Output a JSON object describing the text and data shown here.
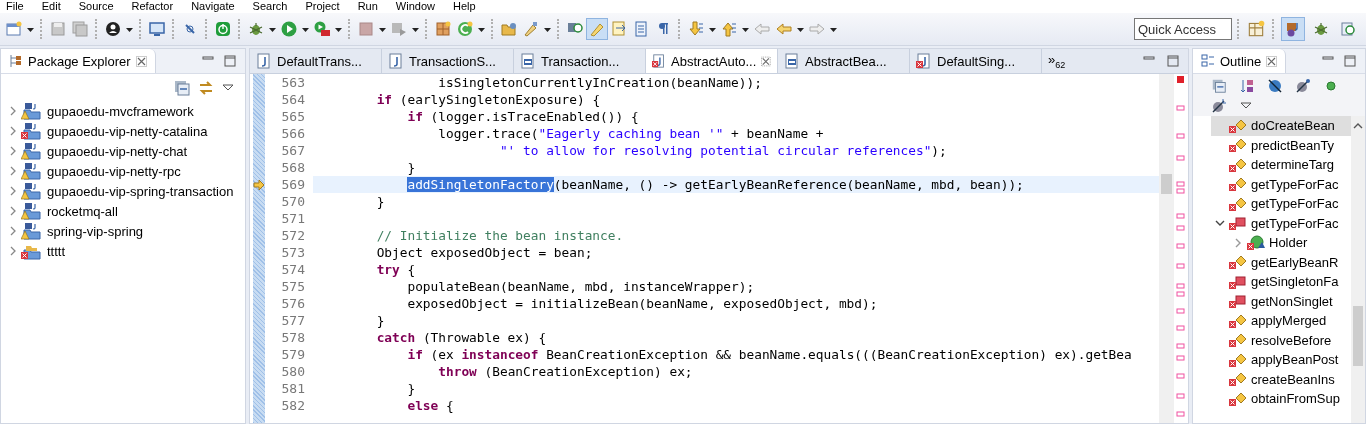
{
  "menu_bar": [
    "File",
    "Edit",
    "Source",
    "Refactor",
    "Navigate",
    "Search",
    "Project",
    "Run",
    "Window",
    "Help"
  ],
  "toolbar": {
    "highlight_toggle": {
      "selected": true
    },
    "quick_access": {
      "placeholder": "Quick Access"
    },
    "perspectives": [
      {
        "kind": "javaee",
        "selected": true
      },
      {
        "kind": "debug",
        "selected": false
      },
      {
        "kind": "search",
        "selected": false
      }
    ]
  },
  "package_explorer": {
    "title": "Package Explorer",
    "projects": [
      {
        "name": "gupaoedu-mvcframework",
        "kind": "maven",
        "has_error": false,
        "expanded": false
      },
      {
        "name": "gupaoedu-vip-netty-catalina",
        "kind": "maven",
        "has_error": true,
        "expanded": false
      },
      {
        "name": "gupaoedu-vip-netty-chat",
        "kind": "maven",
        "has_error": false,
        "expanded": false
      },
      {
        "name": "gupaoedu-vip-netty-rpc",
        "kind": "maven",
        "has_error": false,
        "expanded": false
      },
      {
        "name": "gupaoedu-vip-spring-transaction",
        "kind": "maven",
        "has_error": false,
        "expanded": false
      },
      {
        "name": "rocketmq-all",
        "kind": "maven",
        "has_error": false,
        "expanded": false
      },
      {
        "name": "spring-vip-spring",
        "kind": "maven",
        "has_error": false,
        "expanded": false
      },
      {
        "name": "ttttt",
        "kind": "plain",
        "has_error": true,
        "expanded": false
      }
    ]
  },
  "editor": {
    "tabs": [
      {
        "label": "DefaultTrans...",
        "kind": "source",
        "error": false,
        "selected": false
      },
      {
        "label": "TransactionS...",
        "kind": "source",
        "error": false,
        "selected": false
      },
      {
        "label": "Transaction...",
        "kind": "class",
        "error": false,
        "selected": false
      },
      {
        "label": "AbstractAuto...",
        "kind": "source",
        "error": true,
        "selected": true
      },
      {
        "label": "AbstractBea...",
        "kind": "class",
        "error": false,
        "selected": false
      },
      {
        "label": "DefaultSing...",
        "kind": "source",
        "error": true,
        "selected": false
      }
    ],
    "overflow": {
      "chevron": "»",
      "count": "62"
    },
    "lines": [
      {
        "number": "563",
        "current": false,
        "segments": [
          {
            "kind": "plain",
            "text": "                isSingletonCurrentlyInCreation(beanName));"
          }
        ]
      },
      {
        "number": "564",
        "current": false,
        "segments": [
          {
            "kind": "keyword",
            "text": "        if"
          },
          {
            "kind": "plain",
            "text": " (earlySingletonExposure) {"
          }
        ]
      },
      {
        "number": "565",
        "current": false,
        "segments": [
          {
            "kind": "keyword",
            "text": "            if"
          },
          {
            "kind": "plain",
            "text": " (logger.isTraceEnabled()) {"
          }
        ]
      },
      {
        "number": "566",
        "current": false,
        "segments": [
          {
            "kind": "plain",
            "text": "                logger.trace("
          },
          {
            "kind": "string",
            "text": "\"Eagerly caching bean '\""
          },
          {
            "kind": "plain",
            "text": " + beanName +"
          }
        ]
      },
      {
        "number": "567",
        "current": false,
        "segments": [
          {
            "kind": "string",
            "text": "                        \"' to allow for resolving potential circular references\""
          },
          {
            "kind": "plain",
            "text": ");"
          }
        ]
      },
      {
        "number": "568",
        "current": false,
        "segments": [
          {
            "kind": "plain",
            "text": "            }"
          }
        ]
      },
      {
        "number": "569",
        "current": true,
        "segments": [
          {
            "kind": "selection",
            "text": "            addSingletonFactory"
          },
          {
            "kind": "plain",
            "text": "(beanName, () -> getEarlyBeanReference(beanName, mbd, bean));"
          }
        ]
      },
      {
        "number": "570",
        "current": false,
        "segments": [
          {
            "kind": "plain",
            "text": "        }"
          }
        ]
      },
      {
        "number": "571",
        "current": false
      },
      {
        "number": "572",
        "current": false,
        "segments": [
          {
            "kind": "comment",
            "text": "        // Initialize the bean instance."
          }
        ]
      },
      {
        "number": "573",
        "current": false,
        "segments": [
          {
            "kind": "plain",
            "text": "        Object exposedObject = bean;"
          }
        ]
      },
      {
        "number": "574",
        "current": false,
        "segments": [
          {
            "kind": "keyword",
            "text": "        try"
          },
          {
            "kind": "plain",
            "text": " {"
          }
        ]
      },
      {
        "number": "575",
        "current": false,
        "segments": [
          {
            "kind": "plain",
            "text": "            populateBean(beanName, mbd, instanceWrapper);"
          }
        ]
      },
      {
        "number": "576",
        "current": false,
        "segments": [
          {
            "kind": "plain",
            "text": "            exposedObject = initializeBean(beanName, exposedObject, mbd);"
          }
        ]
      },
      {
        "number": "577",
        "current": false,
        "segments": [
          {
            "kind": "plain",
            "text": "        }"
          }
        ]
      },
      {
        "number": "578",
        "current": false,
        "segments": [
          {
            "kind": "keyword",
            "text": "        catch"
          },
          {
            "kind": "plain",
            "text": " (Throwable ex) {"
          }
        ]
      },
      {
        "number": "579",
        "current": false,
        "segments": [
          {
            "kind": "keyword",
            "text": "            if"
          },
          {
            "kind": "plain",
            "text": " (ex "
          },
          {
            "kind": "keyword",
            "text": "instanceof"
          },
          {
            "kind": "plain",
            "text": " BeanCreationException && beanName.equals(((BeanCreationException) ex).getBea"
          }
        ]
      },
      {
        "number": "580",
        "current": false,
        "segments": [
          {
            "kind": "keyword",
            "text": "                throw"
          },
          {
            "kind": "plain",
            "text": " (BeanCreationException) ex;"
          }
        ]
      },
      {
        "number": "581",
        "current": false,
        "segments": [
          {
            "kind": "plain",
            "text": "            }"
          }
        ]
      },
      {
        "number": "582",
        "current": false,
        "segments": [
          {
            "kind": "keyword",
            "text": "            else"
          },
          {
            "kind": "plain",
            "text": " {"
          }
        ]
      }
    ]
  },
  "outline": {
    "title": "Outline",
    "items": [
      {
        "name": "doCreateBean",
        "kind": "protected",
        "selected": true
      },
      {
        "name": "predictBeanTy",
        "kind": "protected",
        "selected": false
      },
      {
        "name": "determineTarg",
        "kind": "protected",
        "selected": false
      },
      {
        "name": "getTypeForFac",
        "kind": "protected",
        "selected": false
      },
      {
        "name": "getTypeForFac",
        "kind": "protected",
        "selected": false
      },
      {
        "name": "getTypeForFac",
        "kind": "private",
        "selected": false,
        "expanded": true,
        "children": [
          {
            "name": "Holder",
            "kind": "class",
            "selected": false,
            "expanded": false
          }
        ]
      },
      {
        "name": "getEarlyBeanR",
        "kind": "protected",
        "selected": false
      },
      {
        "name": "getSingletonFa",
        "kind": "private",
        "selected": false
      },
      {
        "name": "getNonSinglet",
        "kind": "private",
        "selected": false
      },
      {
        "name": "applyMerged",
        "kind": "protected",
        "selected": false
      },
      {
        "name": "resolveBefore",
        "kind": "protected",
        "selected": false
      },
      {
        "name": "applyBeanPost",
        "kind": "protected",
        "selected": false
      },
      {
        "name": "createBeanIns",
        "kind": "protected",
        "selected": false
      },
      {
        "name": "obtainFromSup",
        "kind": "protected",
        "selected": false
      }
    ]
  }
}
